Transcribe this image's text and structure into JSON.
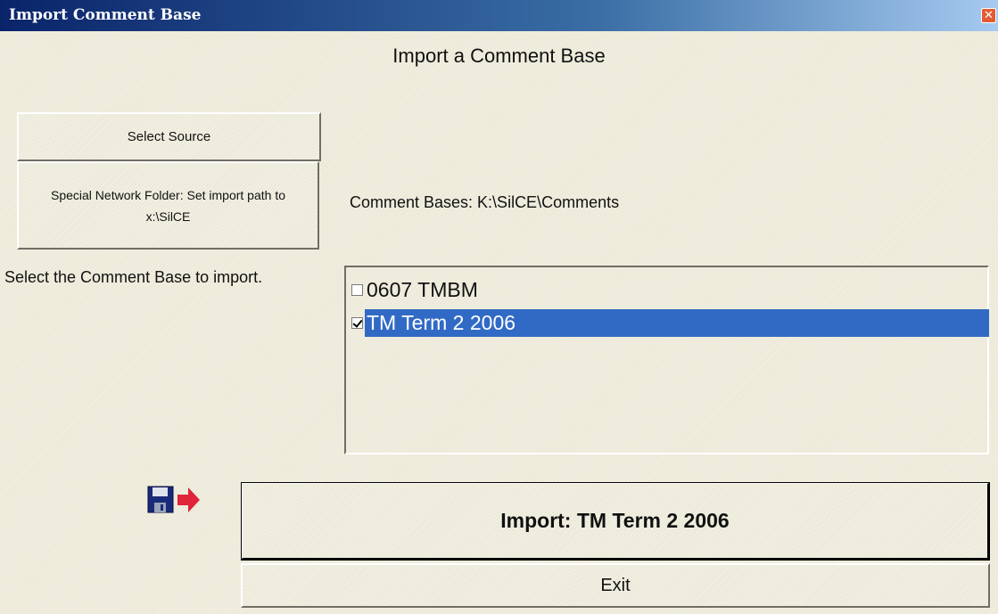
{
  "window": {
    "title": "Import Comment Base",
    "close_glyph": "✕"
  },
  "heading": "Import a Comment Base",
  "buttons": {
    "select_source": "Select Source",
    "special_network_folder": "Special Network Folder: Set import path to x:\\SilCE",
    "import": "Import: TM Term 2  2006",
    "exit": "Exit"
  },
  "comment_bases_label": "Comment Bases: K:\\SilCE\\Comments",
  "select_prompt": "Select the Comment Base to import.",
  "comment_bases": [
    {
      "label": "0607 TMBM",
      "checked": false,
      "selected": false
    },
    {
      "label": "TM Term 2  2006",
      "checked": true,
      "selected": true
    }
  ],
  "icons": {
    "import": "save-to-arrow-icon"
  },
  "colors": {
    "title_bar": "#0a246a",
    "selection": "#316ac5",
    "face": "#ece9d8",
    "close": "#e25b34",
    "arrow": "#e0243a"
  }
}
